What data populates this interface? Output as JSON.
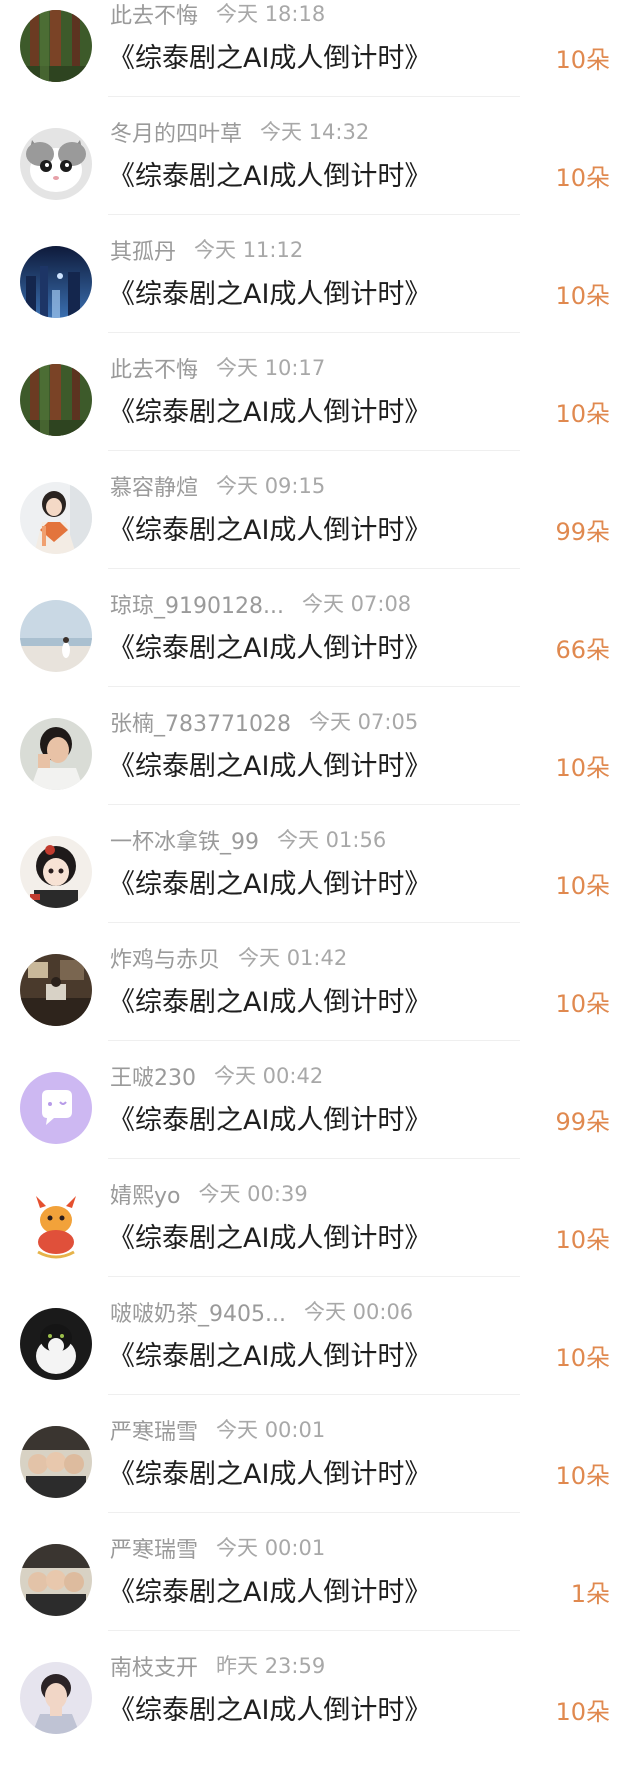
{
  "records": [
    {
      "name": "此去不悔",
      "time": "今天 18:18",
      "title": "《综泰剧之AI成人倒计时》",
      "gift": "10朵",
      "avatar": "forest-avatar"
    },
    {
      "name": "冬月的四叶草",
      "time": "今天 14:32",
      "title": "《综泰剧之AI成人倒计时》",
      "gift": "10朵",
      "avatar": "cat-avatar"
    },
    {
      "name": "其孤丹",
      "time": "今天 11:12",
      "title": "《综泰剧之AI成人倒计时》",
      "gift": "10朵",
      "avatar": "city-night-avatar"
    },
    {
      "name": "此去不悔",
      "time": "今天 10:17",
      "title": "《综泰剧之AI成人倒计时》",
      "gift": "10朵",
      "avatar": "forest-avatar"
    },
    {
      "name": "慕容静煊",
      "time": "今天 09:15",
      "title": "《综泰剧之AI成人倒计时》",
      "gift": "99朵",
      "avatar": "costume-girl-avatar"
    },
    {
      "name": "琼琼_9190128...",
      "time": "今天 07:08",
      "title": "《综泰剧之AI成人倒计时》",
      "gift": "66朵",
      "avatar": "beach-avatar"
    },
    {
      "name": "张楠_783771028",
      "time": "今天 07:05",
      "title": "《综泰剧之AI成人倒计时》",
      "gift": "10朵",
      "avatar": "girl-portrait-avatar"
    },
    {
      "name": "一杯冰拿铁_99",
      "time": "今天 01:56",
      "title": "《综泰剧之AI成人倒计时》",
      "gift": "10朵",
      "avatar": "anime-girl-avatar"
    },
    {
      "name": "炸鸡与赤贝",
      "time": "今天 01:42",
      "title": "《综泰剧之AI成人倒计时》",
      "gift": "10朵",
      "avatar": "room-avatar"
    },
    {
      "name": "王啵230",
      "time": "今天 00:42",
      "title": "《综泰剧之AI成人倒计时》",
      "gift": "99朵",
      "avatar": "default-chat-avatar"
    },
    {
      "name": "婧熙yo",
      "time": "今天 00:39",
      "title": "《综泰剧之AI成人倒计时》",
      "gift": "10朵",
      "avatar": "dragon-cartoon-avatar"
    },
    {
      "name": "啵啵奶茶_9405...",
      "time": "今天 00:06",
      "title": "《综泰剧之AI成人倒计时》",
      "gift": "10朵",
      "avatar": "black-white-cat-avatar"
    },
    {
      "name": "严寒瑞雪",
      "time": "今天 00:01",
      "title": "《综泰剧之AI成人倒计时》",
      "gift": "10朵",
      "avatar": "group-photo-avatar"
    },
    {
      "name": "严寒瑞雪",
      "time": "今天 00:01",
      "title": "《综泰剧之AI成人倒计时》",
      "gift": "1朵",
      "avatar": "group-photo-avatar"
    },
    {
      "name": "南枝支开",
      "time": "昨天 23:59",
      "title": "《综泰剧之AI成人倒计时》",
      "gift": "10朵",
      "avatar": "man-portrait-avatar"
    }
  ],
  "colors": {
    "name": "#9a9a9a",
    "time": "#a8a8a8",
    "title": "#1e1e1e",
    "gift": "#e0894f",
    "divider": "#efefef"
  }
}
